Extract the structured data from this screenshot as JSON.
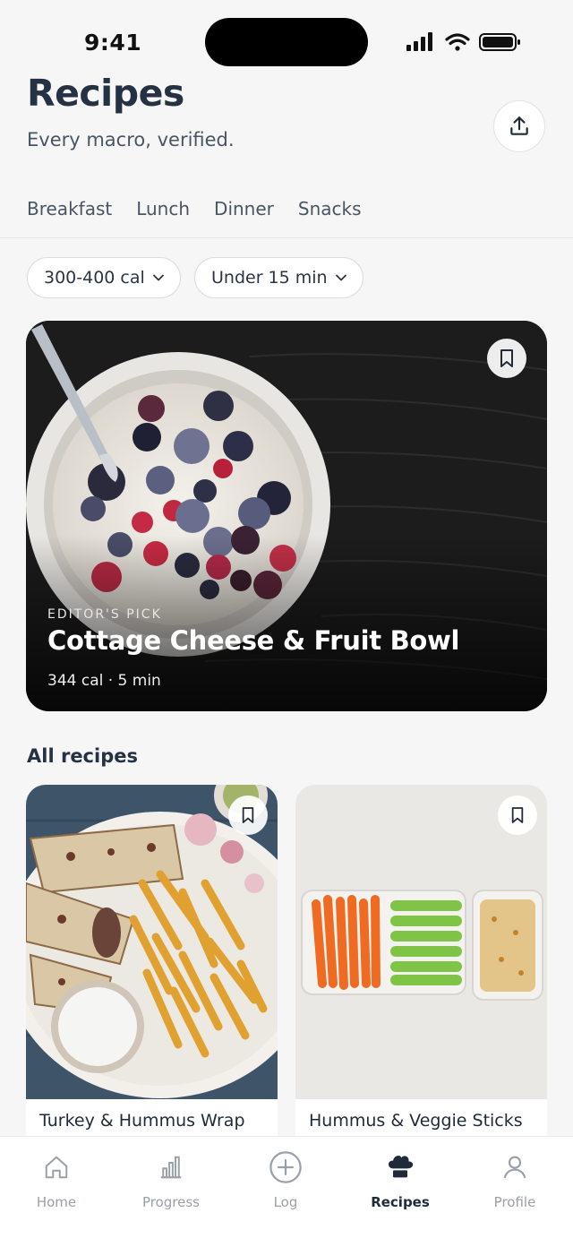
{
  "status_bar": {
    "time": "9:41"
  },
  "header": {
    "title": "Recipes",
    "subtitle": "Every macro, verified."
  },
  "tabs": [
    "Breakfast",
    "Lunch",
    "Dinner",
    "Snacks"
  ],
  "filters": [
    {
      "label": "300-400 cal"
    },
    {
      "label": "Under 15 min"
    }
  ],
  "featured": {
    "kicker": "EDITOR'S PICK",
    "title": "Cottage Cheese & Fruit Bowl",
    "meta": "344 cal · 5 min"
  },
  "all_recipes": {
    "title": "All recipes",
    "items": [
      {
        "title": "Turkey & Hummus Wrap"
      },
      {
        "title": "Hummus & Veggie Sticks"
      }
    ]
  },
  "tabbar": {
    "items": [
      {
        "label": "Home",
        "icon": "home-icon"
      },
      {
        "label": "Progress",
        "icon": "chart-icon"
      },
      {
        "label": "Log",
        "icon": "plus-circle-icon"
      },
      {
        "label": "Recipes",
        "icon": "chef-hat-icon",
        "active": true
      },
      {
        "label": "Profile",
        "icon": "user-icon"
      }
    ]
  },
  "colors": {
    "text_primary": "#253244",
    "text_secondary": "#4a5563",
    "tab_inactive": "#9aa0a8",
    "background": "#f6f6f6"
  }
}
